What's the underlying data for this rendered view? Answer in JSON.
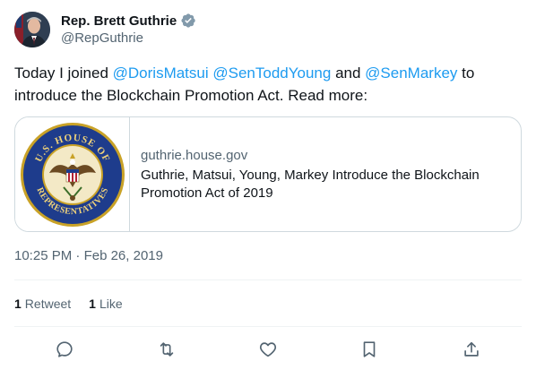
{
  "author": {
    "display_name": "Rep. Brett Guthrie",
    "handle": "@RepGuthrie",
    "avatar_icon": "profile-photo",
    "verified_icon": "verified-badge-icon",
    "verified_color": "#829aab"
  },
  "tweet": {
    "text_before": "Today I joined ",
    "mention1": "@DorisMatsui",
    "space1": " ",
    "mention2": "@SenToddYoung",
    "and_text": " and ",
    "mention3": "@SenMarkey",
    "text_after": " to introduce the Blockchain Promotion Act. Read more:"
  },
  "card": {
    "image_icon": "us-house-of-representatives-seal",
    "seal_text_top": "U.S. HOUSE OF",
    "seal_text_bottom": "REPRESENTATIVES",
    "domain": "guthrie.house.gov",
    "title": "Guthrie, Matsui, Young, Markey Introduce the Blockchain Promotion Act of 2019"
  },
  "meta": {
    "time": "10:25 PM",
    "separator": " · ",
    "date": "Feb 26, 2019"
  },
  "stats": {
    "retweets_count": "1",
    "retweets_label": "Retweet",
    "likes_count": "1",
    "likes_label": "Like"
  },
  "colors": {
    "mention": "#1d9bf0",
    "secondary_text": "#536471",
    "border": "#cfd9de",
    "divider": "#eff3f4"
  },
  "actions": [
    "reply-icon",
    "retweet-icon",
    "like-icon",
    "bookmark-icon",
    "share-icon"
  ]
}
